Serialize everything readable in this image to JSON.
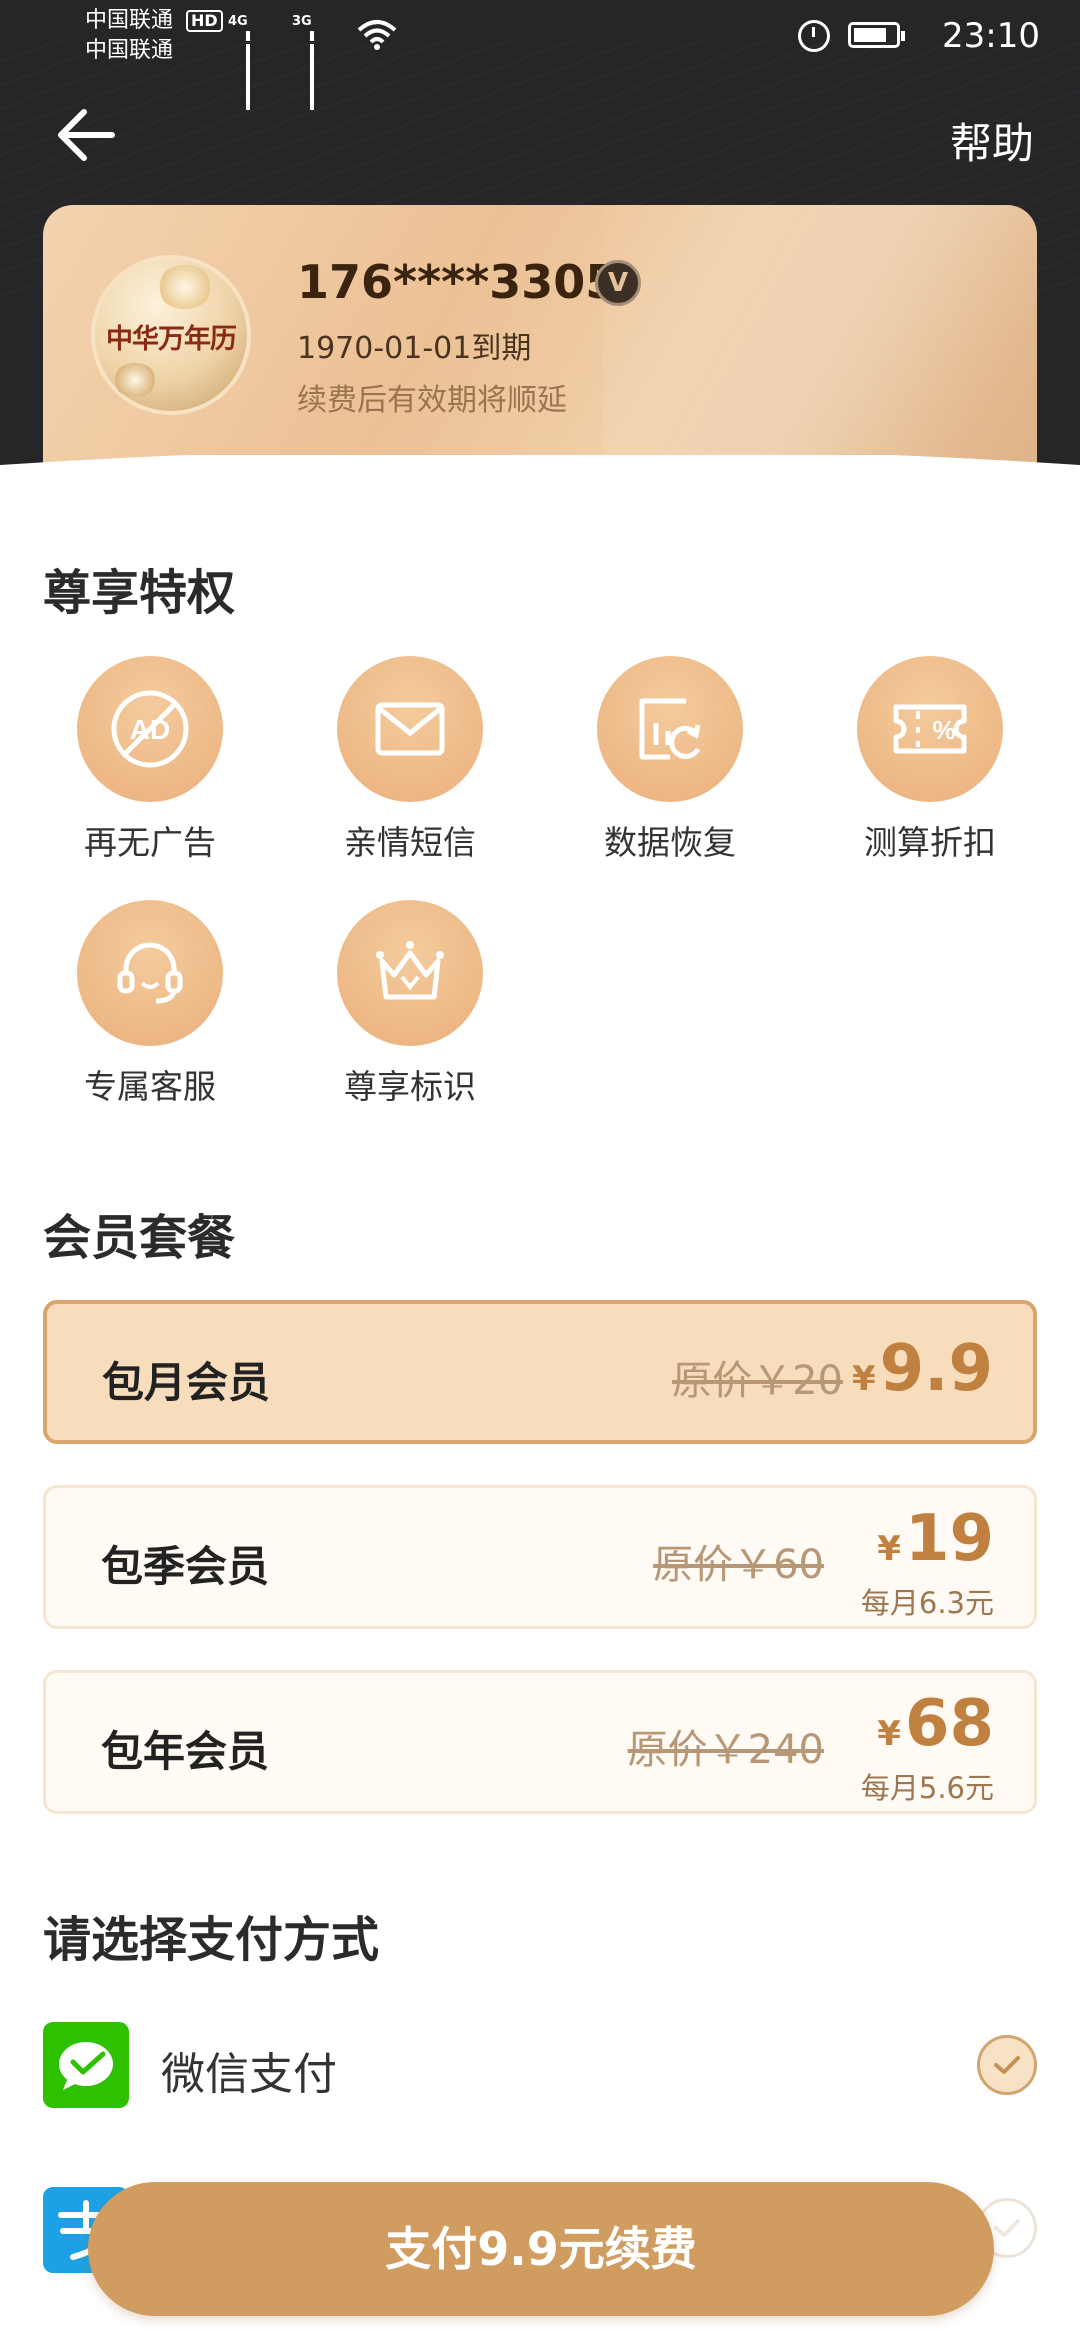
{
  "status_bar": {
    "carrier_1": "中国联通",
    "carrier_2": "中国联通",
    "hd": "HD",
    "net_1": "4G",
    "net_2": "3G",
    "time": "23:10"
  },
  "header": {
    "back_icon": "arrow-left-icon",
    "help_label": "帮助"
  },
  "member_card": {
    "avatar_text": "中华万年历",
    "phone": "176****3305",
    "vip_badge": "V",
    "expire_text": "1970-01-01到期",
    "renew_note": "续费后有效期将顺延"
  },
  "privileges": {
    "title": "尊享特权",
    "items": [
      {
        "label": "再无广告",
        "icon": "no-ads-icon"
      },
      {
        "label": "亲情短信",
        "icon": "envelope-icon"
      },
      {
        "label": "数据恢复",
        "icon": "data-restore-icon"
      },
      {
        "label": "测算折扣",
        "icon": "discount-ticket-icon"
      },
      {
        "label": "专属客服",
        "icon": "headset-icon"
      },
      {
        "label": "尊享标识",
        "icon": "crown-icon"
      }
    ]
  },
  "plans": {
    "title": "会员套餐",
    "items": [
      {
        "name": "包月会员",
        "original": "原价￥20",
        "currency": "¥",
        "price": "9.9",
        "sub": "",
        "selected": true
      },
      {
        "name": "包季会员",
        "original": "原价￥60",
        "currency": "¥",
        "price": "19",
        "sub": "每月6.3元",
        "selected": false
      },
      {
        "name": "包年会员",
        "original": "原价￥240",
        "currency": "¥",
        "price": "68",
        "sub": "每月5.6元",
        "selected": false
      }
    ]
  },
  "payment": {
    "title": "请选择支付方式",
    "methods": [
      {
        "label": "微信支付",
        "icon": "wechat-pay-icon",
        "selected": true
      },
      {
        "label": "",
        "icon": "alipay-icon",
        "selected": false
      }
    ]
  },
  "pay_button": {
    "label": "支付9.9元续费"
  },
  "colors": {
    "accent": "#d19c5f",
    "card_gold": "#ecc196",
    "selected_plan_bg": "#f8ddbd",
    "price_text": "#c0803f",
    "wechat_green": "#2dc100",
    "alipay_blue": "#1da1e6"
  }
}
